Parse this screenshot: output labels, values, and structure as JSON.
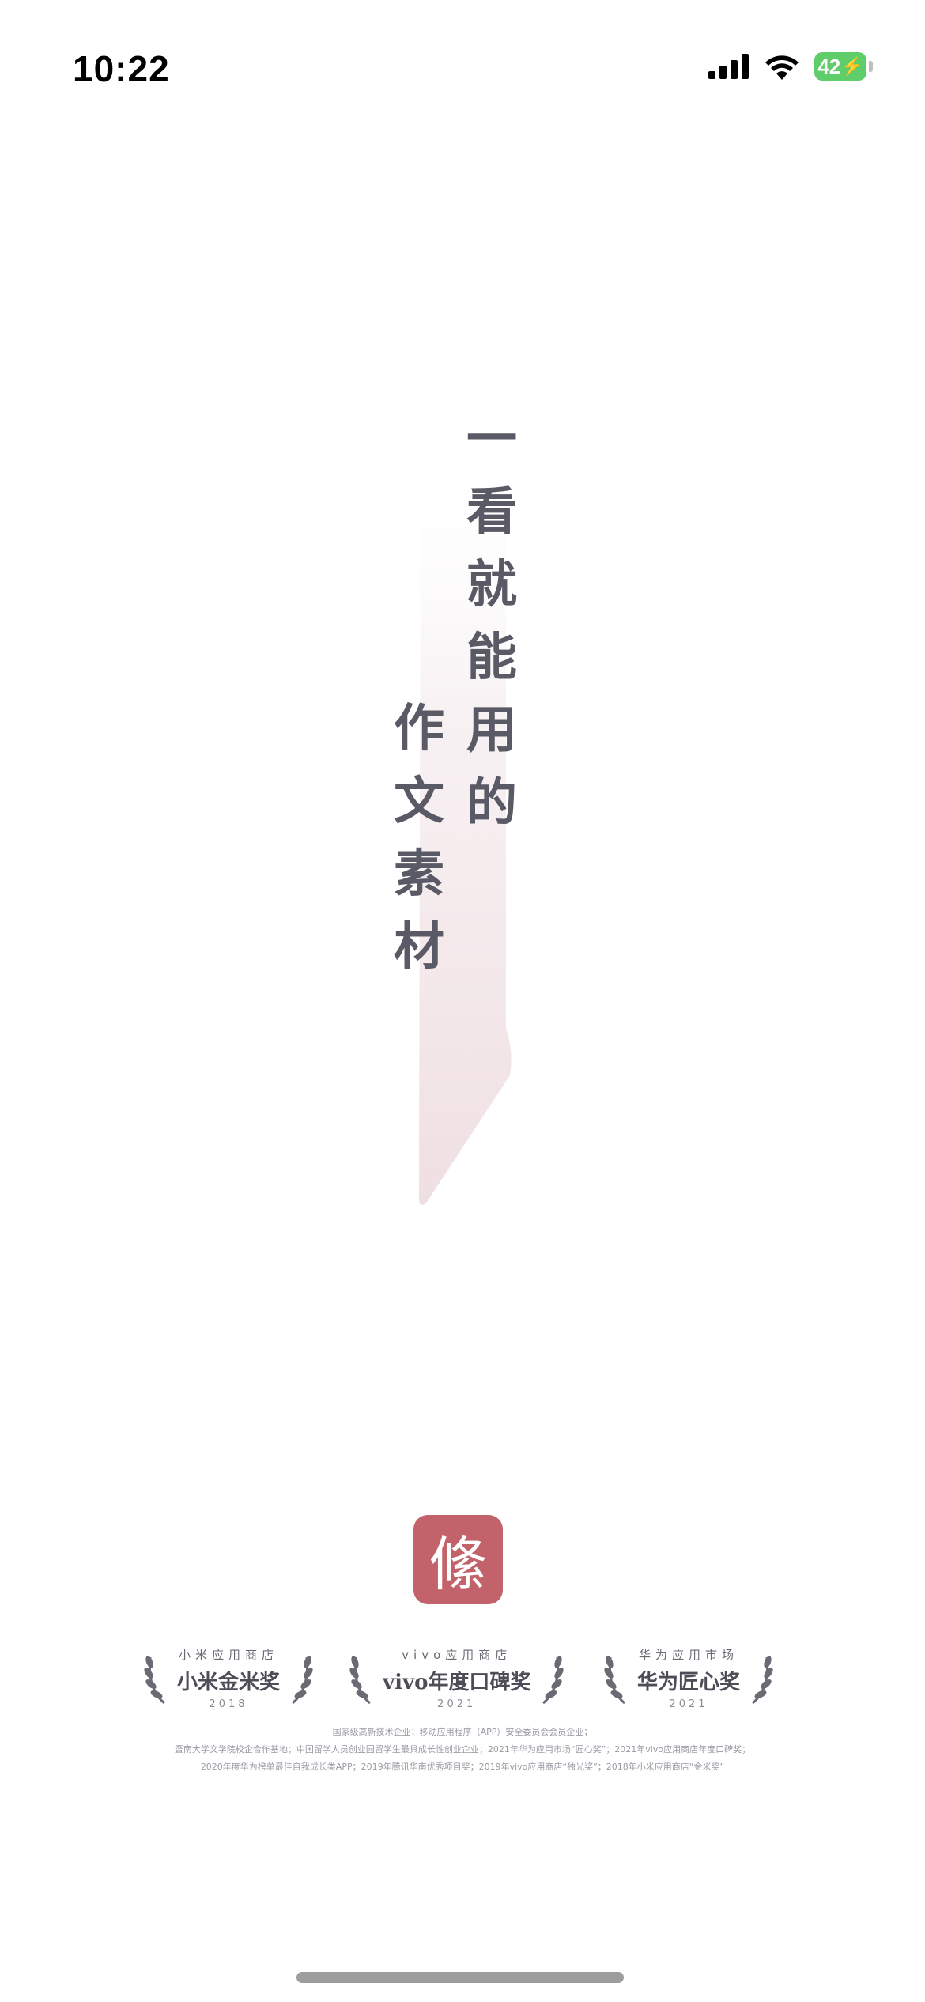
{
  "status_bar": {
    "time": "10:22",
    "battery": "42"
  },
  "slogan": {
    "right_column": [
      "一",
      "看",
      "就",
      "能",
      "用",
      "的"
    ],
    "left_column": [
      "作",
      "文",
      "素",
      "材"
    ]
  },
  "logo": {
    "glyph": "絛",
    "color": "#c2626a"
  },
  "awards": [
    {
      "top": "小米应用商店",
      "name": "小米金米奖",
      "year": "2018"
    },
    {
      "top": "vivo应用商店",
      "name": "vivo年度口碑奖",
      "year": "2021"
    },
    {
      "top": "华为应用市场",
      "name": "华为匠心奖",
      "year": "2021"
    }
  ],
  "honors": [
    "国家级高新技术企业；移动应用程序（APP）安全委员会会员企业；",
    "暨南大学文学院校企合作基地；中国留学人员创业园留学生最具成长性创业企业；2021年华为应用市场“匠心奖”；2021年vivo应用商店年度口碑奖；",
    "2020年度华为榜单最佳自我成长类APP；2019年腾讯华南优秀项目奖；2019年vivo应用商店“独光奖”；2018年小米应用商店“金米奖”"
  ]
}
